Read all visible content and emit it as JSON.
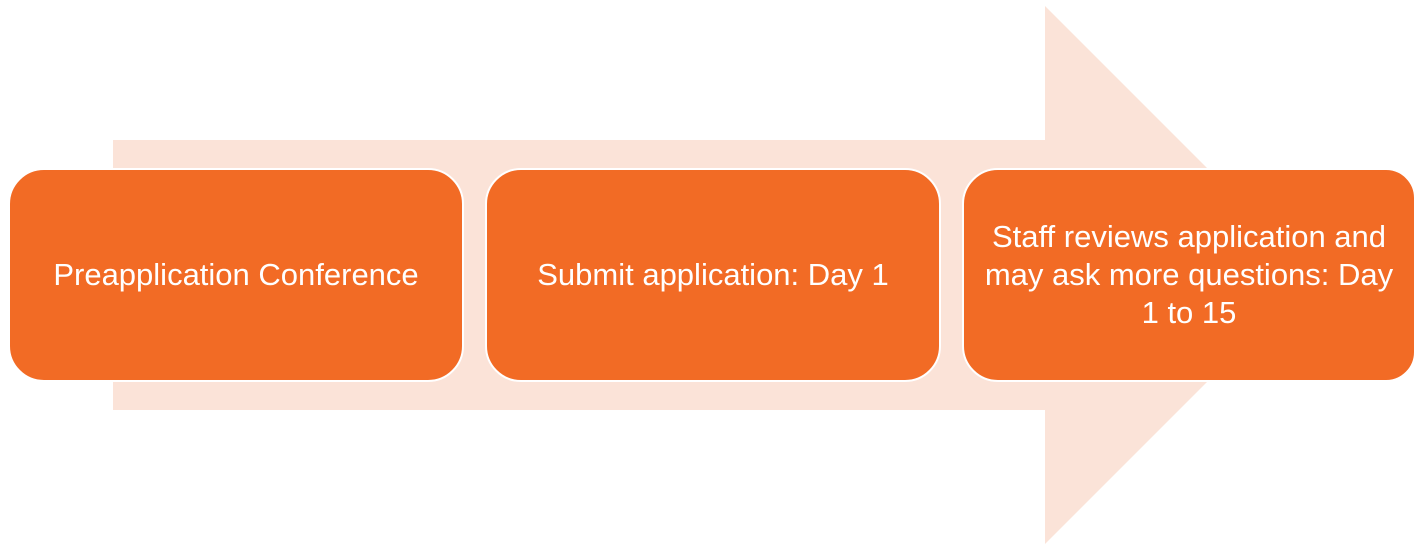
{
  "colors": {
    "arrow_fill": "#FBE3D8",
    "step_fill": "#F26B25",
    "step_text": "#FFFFFF"
  },
  "steps": [
    {
      "label": "Preapplication Conference"
    },
    {
      "label": "Submit application: Day 1"
    },
    {
      "label": "Staff reviews application and may ask more questions: Day 1 to 15"
    }
  ]
}
